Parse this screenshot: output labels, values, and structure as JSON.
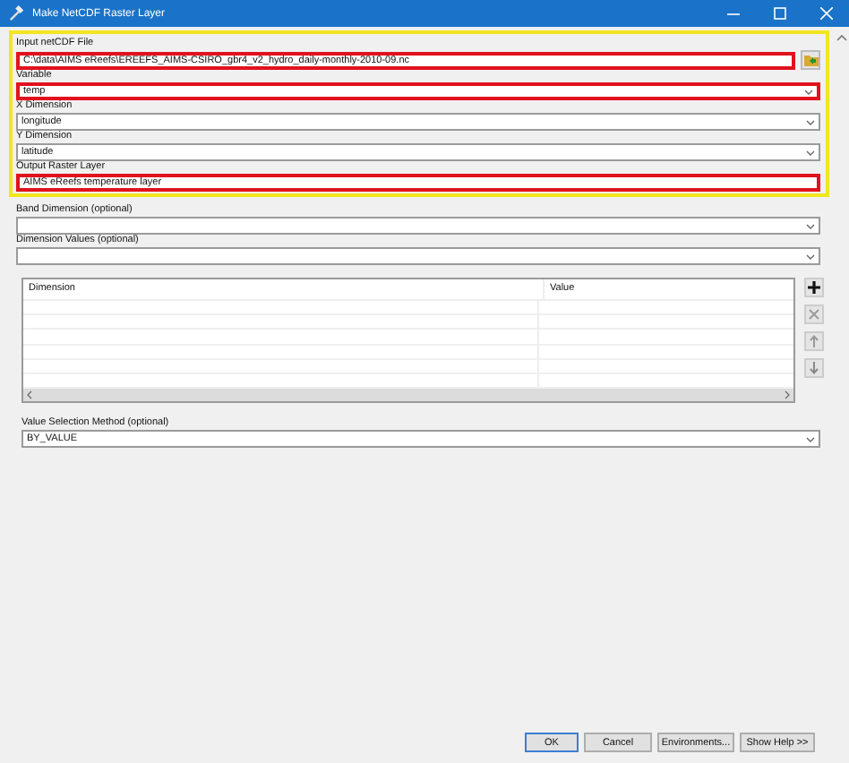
{
  "window": {
    "title": "Make NetCDF Raster Layer"
  },
  "groups": [
    {
      "highlighted": true,
      "parameters": [
        {
          "label": "Input netCDF File",
          "kind": "file",
          "value": "C:\\data\\AIMS eReefs\\EREEFS_AIMS-CSIRO_gbr4_v2_hydro_daily-monthly-2010-09.nc",
          "highlighted": true
        },
        {
          "label": "Variable",
          "kind": "dropdown",
          "value": "temp",
          "highlighted": true
        },
        {
          "label": "X Dimension",
          "kind": "dropdown",
          "value": "longitude",
          "highlighted": false
        },
        {
          "label": "Y Dimension",
          "kind": "dropdown",
          "value": "latitude",
          "highlighted": false
        },
        {
          "label": "Output Raster Layer",
          "kind": "text",
          "value": "AIMS eReefs temperature layer",
          "highlighted": true
        }
      ]
    },
    {
      "highlighted": false,
      "parameters": [
        {
          "label": "Band Dimension (optional)",
          "kind": "dropdown",
          "highlighted": false
        },
        {
          "label": "Dimension Values (optional)",
          "kind": "dropdown",
          "highlighted": false
        }
      ]
    }
  ],
  "dimension_table": {
    "columns": [
      "Dimension",
      "Value"
    ]
  },
  "value_selection_method": {
    "label": "Value Selection Method (optional)",
    "kind": "dropdown",
    "value": "BY_VALUE",
    "highlighted": false
  },
  "buttons": [
    "OK",
    "Cancel",
    "Environments...",
    "Show Help >>"
  ]
}
